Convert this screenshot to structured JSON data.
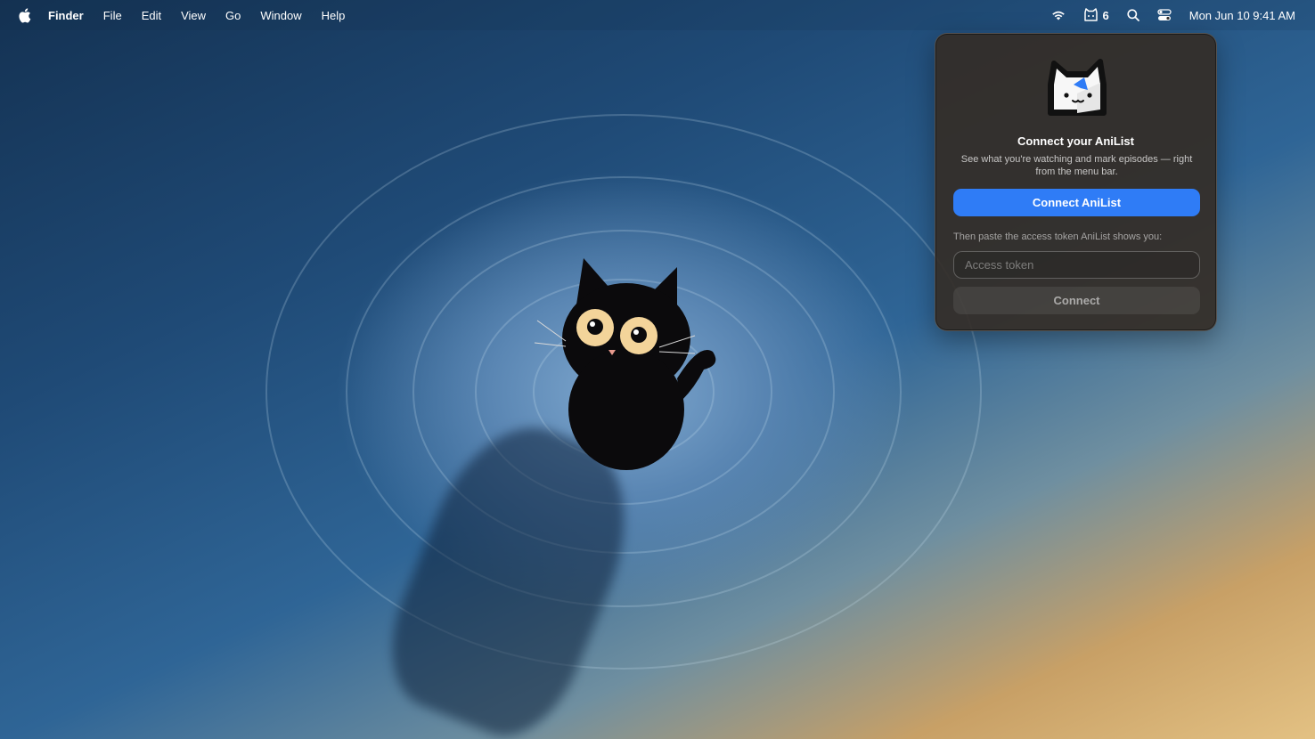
{
  "menubar": {
    "app_name": "Finder",
    "items": [
      "File",
      "Edit",
      "View",
      "Go",
      "Window",
      "Help"
    ],
    "status": {
      "wifi_icon": "wifi-icon",
      "anilist_icon": "anilist-cat-icon",
      "anilist_count": "6",
      "search_icon": "search-icon",
      "control_center_icon": "control-center-icon",
      "clock": "Mon Jun 10  9:41 AM"
    }
  },
  "popover": {
    "logo_icon": "anilist-cat-logo-icon",
    "title": "Connect your AniList",
    "subtitle": "See what you're watching and mark episodes — right from the menu bar.",
    "connect_anilist_label": "Connect AniList",
    "hint": "Then paste the access token AniList shows you:",
    "token_placeholder": "Access token",
    "token_value": "",
    "connect_label": "Connect"
  },
  "colors": {
    "accent": "#2f7cf6",
    "popover_bg": "#342d26",
    "wallpaper_blue": "#2f6596",
    "wallpaper_sand": "#e3c183"
  }
}
